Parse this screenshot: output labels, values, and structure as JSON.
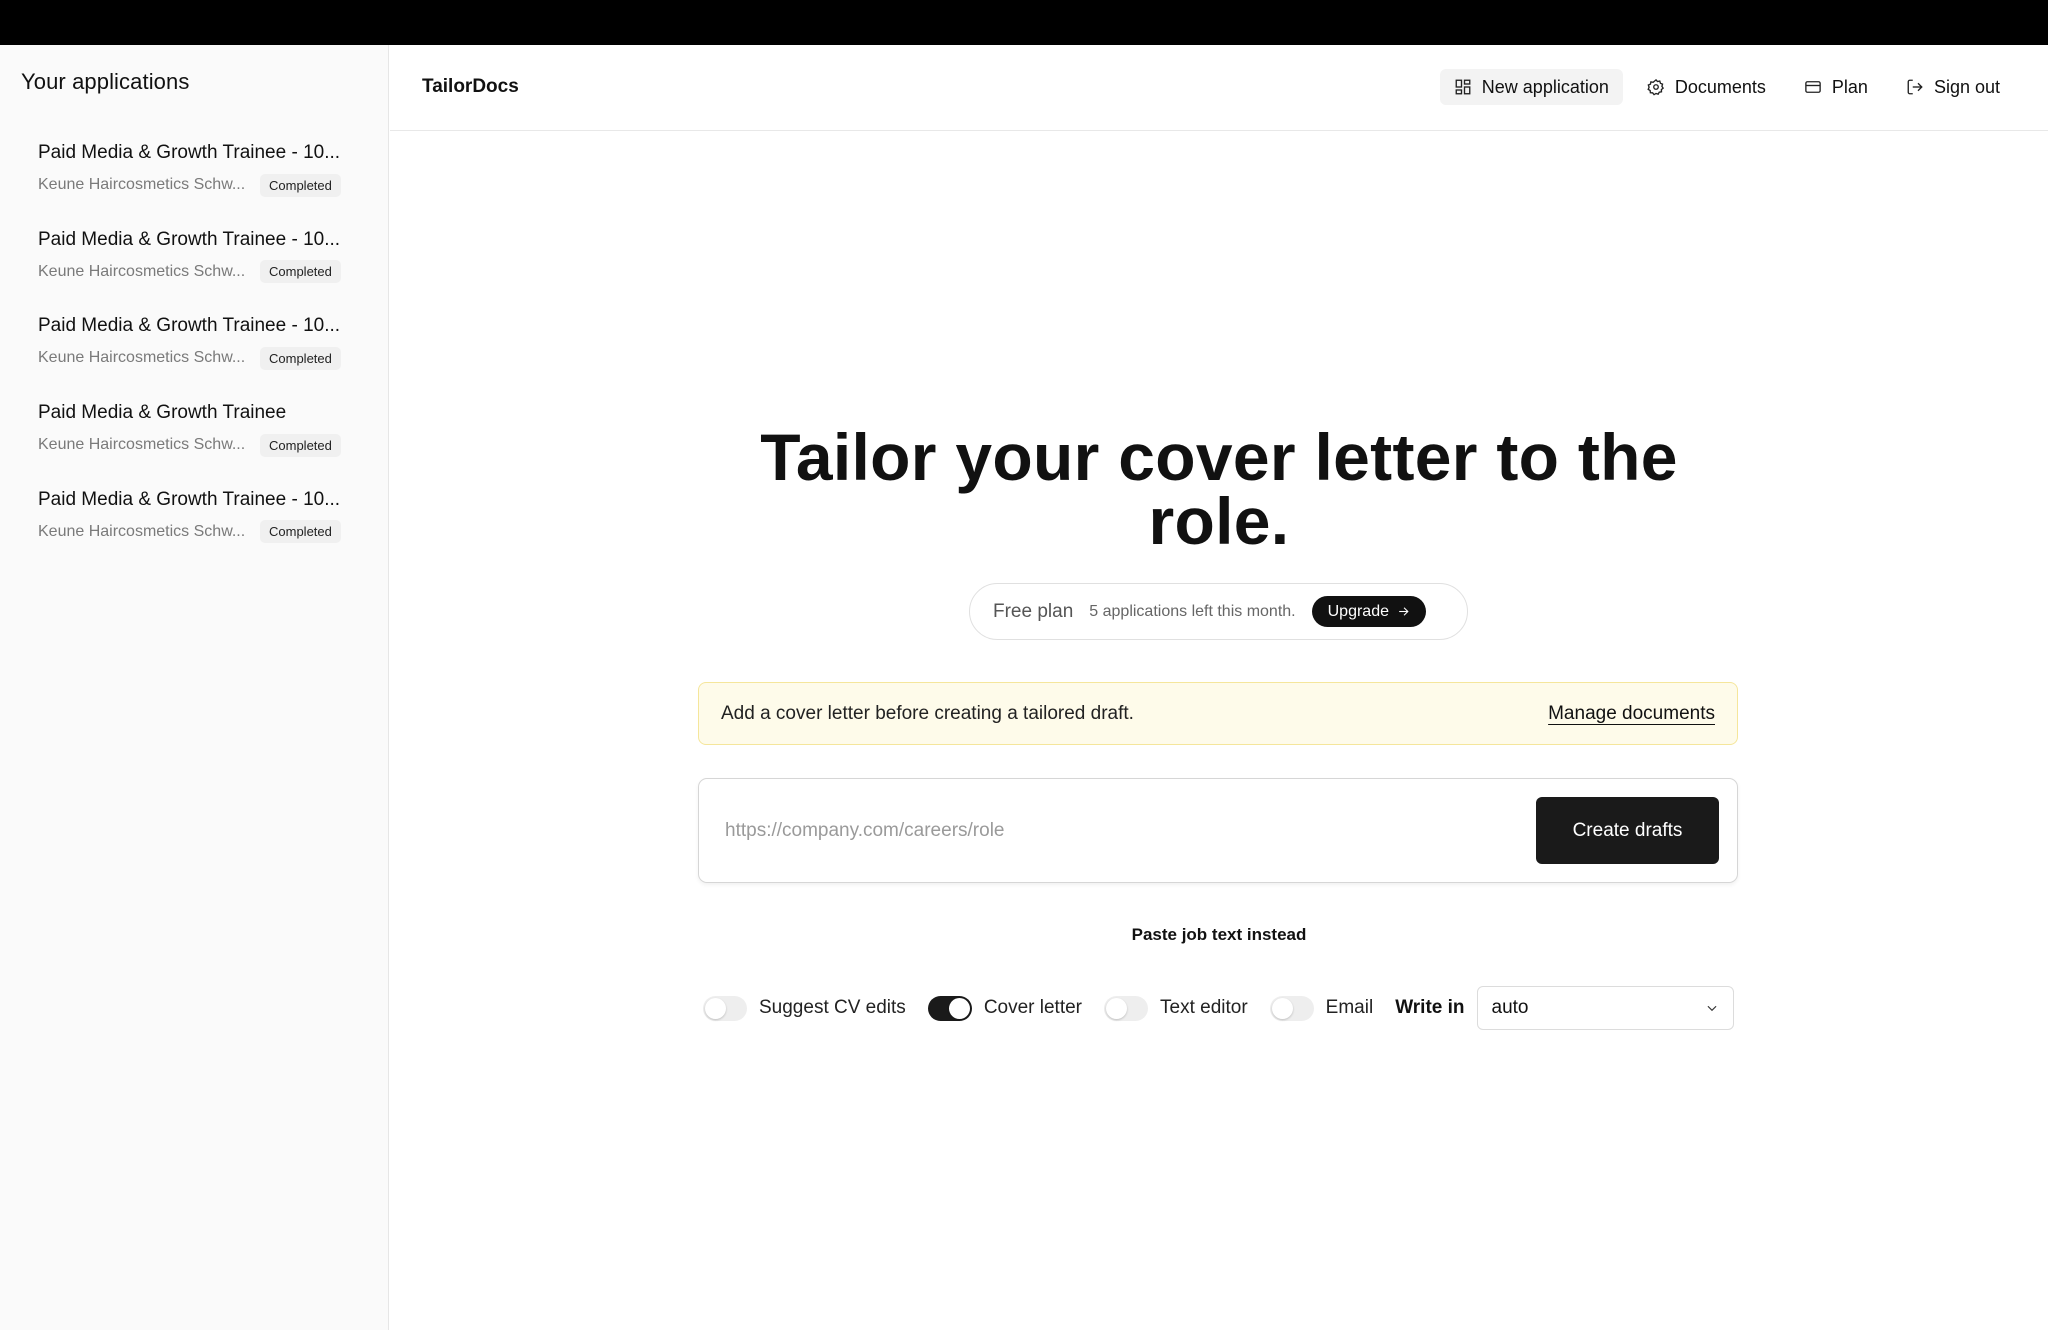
{
  "sidebar": {
    "title": "Your applications",
    "items": [
      {
        "title": "Paid Media & Growth Trainee - 10...",
        "company": "Keune Haircosmetics Schw...",
        "status": "Completed"
      },
      {
        "title": "Paid Media & Growth Trainee - 10...",
        "company": "Keune Haircosmetics Schw...",
        "status": "Completed"
      },
      {
        "title": "Paid Media & Growth Trainee - 10...",
        "company": "Keune Haircosmetics Schw...",
        "status": "Completed"
      },
      {
        "title": "Paid Media & Growth Trainee",
        "company": "Keune Haircosmetics Schw...",
        "status": "Completed"
      },
      {
        "title": "Paid Media & Growth Trainee - 10...",
        "company": "Keune Haircosmetics Schw...",
        "status": "Completed"
      }
    ]
  },
  "header": {
    "brand": "TailorDocs",
    "nav": {
      "new_application": "New application",
      "documents": "Documents",
      "plan": "Plan",
      "sign_out": "Sign out"
    }
  },
  "hero": {
    "title": "Tailor your cover letter to the role."
  },
  "plan": {
    "name": "Free plan",
    "remaining": "5 applications left this month.",
    "upgrade": "Upgrade"
  },
  "notice": {
    "text": "Add a cover letter before creating a tailored draft.",
    "link": "Manage documents"
  },
  "url_form": {
    "placeholder": "https://company.com/careers/role",
    "value": "",
    "submit": "Create drafts"
  },
  "paste_link": "Paste job text instead",
  "options": {
    "suggest_cv": {
      "label": "Suggest CV edits",
      "on": false
    },
    "cover_letter": {
      "label": "Cover letter",
      "on": true
    },
    "text_editor": {
      "label": "Text editor",
      "on": false
    },
    "email": {
      "label": "Email",
      "on": false
    },
    "write_in_label": "Write in",
    "write_in_value": "auto"
  },
  "colors": {
    "accent": "#111111",
    "notice_bg": "#fefbea",
    "notice_border": "#f5e69b"
  }
}
